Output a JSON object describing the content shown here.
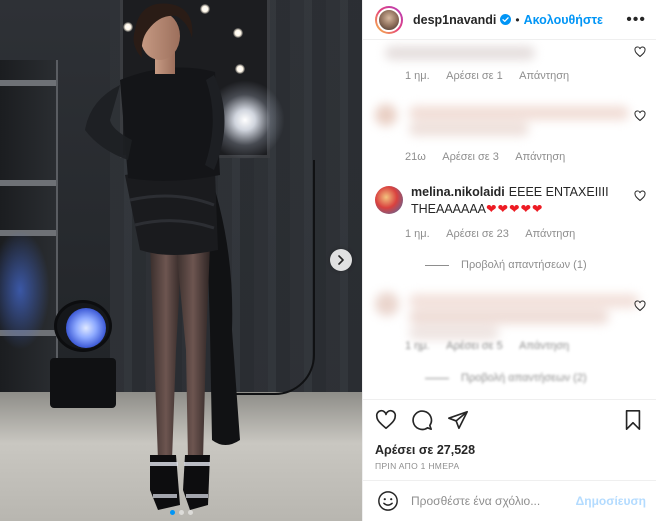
{
  "header": {
    "username": "desp1navandi",
    "separator": "•",
    "follow_label": "Ακολουθήστε",
    "more_label": "•••"
  },
  "comments": [
    {
      "blurred": true,
      "time": "1 ημ.",
      "likes": "Αρέσει σε 1",
      "reply": "Απάντηση"
    },
    {
      "blurred": true,
      "time": "21ω",
      "likes": "Αρέσει σε 3",
      "reply": "Απάντηση"
    },
    {
      "blurred": false,
      "username": "melina.nikolaidi",
      "text": "EEEE ENTAXEIIII THEAAAAAA",
      "emojis": "❤❤❤❤❤",
      "time": "1 ημ.",
      "likes": "Αρέσει σε 23",
      "reply": "Απάντηση",
      "view_replies": "Προβολή απαντήσεων (1)"
    },
    {
      "blurred": true,
      "time": "1 ημ.",
      "likes": "Αρέσει σε 5",
      "reply": "Απάντηση",
      "view_replies": "Προβολή απαντήσεων (2)"
    }
  ],
  "likes": {
    "label": "Αρέσει σε",
    "count": "27,528"
  },
  "timestamp": "ΠΡΙΝ ΑΠΟ 1 ΗΜΕΡΑ",
  "add_comment": {
    "placeholder": "Προσθέστε ένα σχόλιο...",
    "post_label": "Δημοσίευση"
  },
  "carousel": {
    "total": 3,
    "current": 1
  },
  "colors": {
    "accent": "#0095f6",
    "muted": "#8e8e8e",
    "text": "#262626",
    "heart": "#ed1c24"
  }
}
